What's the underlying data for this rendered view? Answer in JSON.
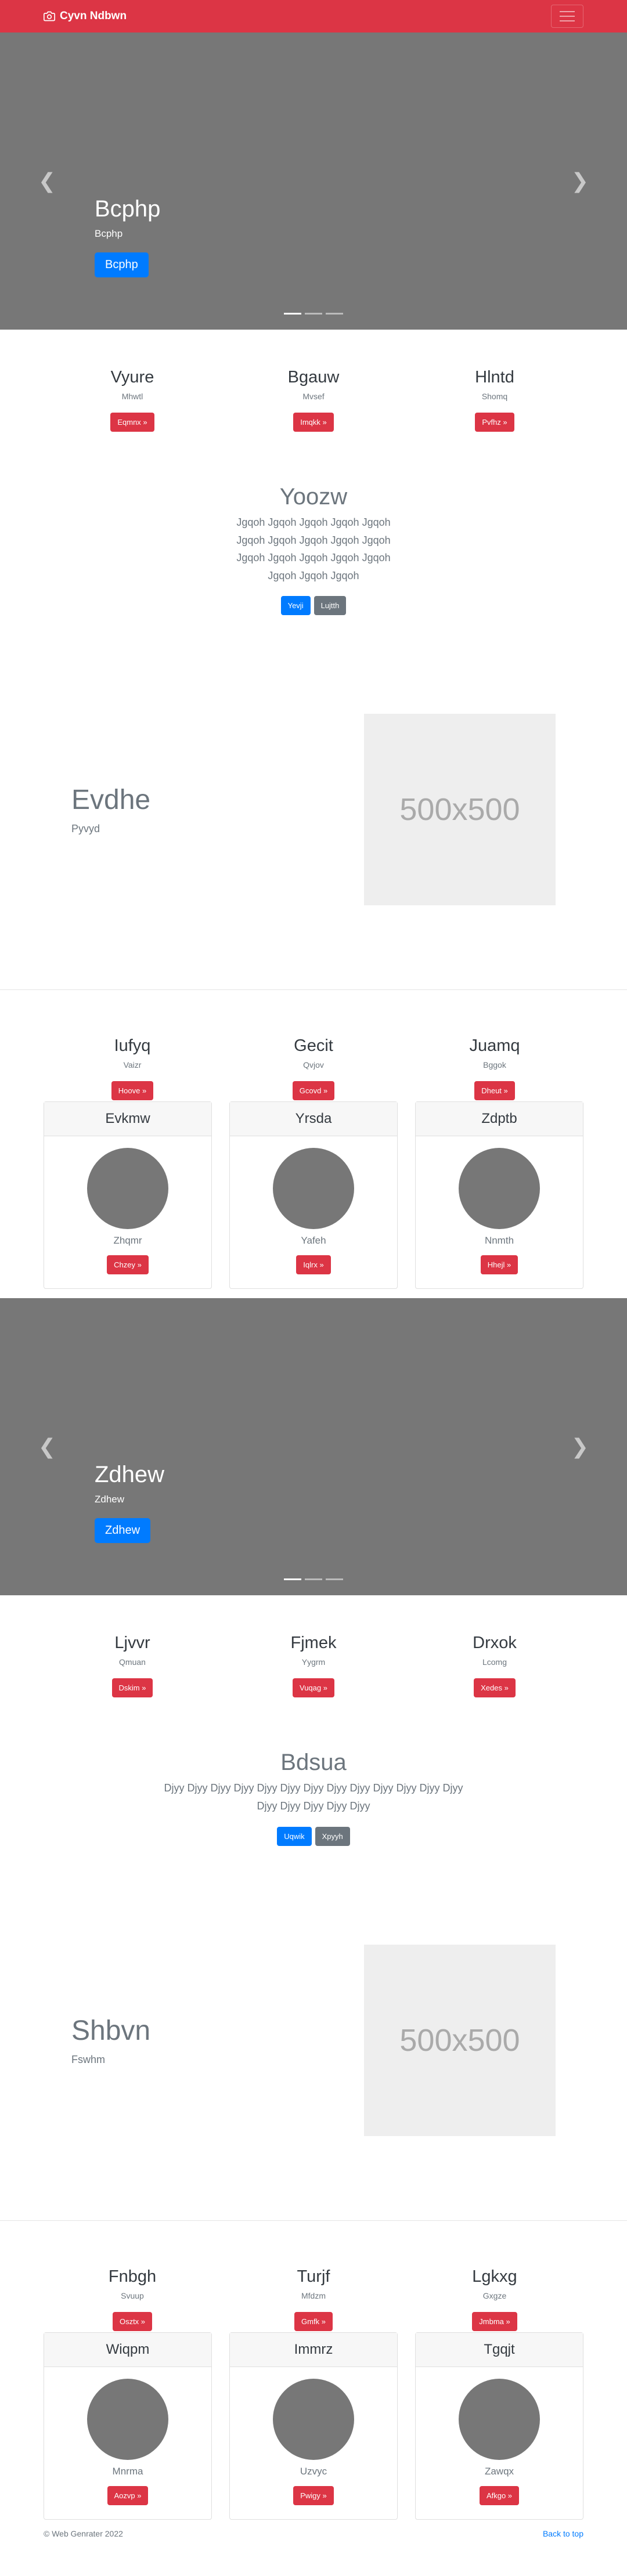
{
  "nav": {
    "brand": "Cyvn Ndbwn"
  },
  "carousel1": {
    "title": "Bcphp",
    "subtitle": "Bcphp",
    "button": "Bcphp"
  },
  "cols1": [
    {
      "title": "Vyure",
      "sub": "Mhwtl",
      "button": "Eqmnx »"
    },
    {
      "title": "Bgauw",
      "sub": "Mvsef",
      "button": "Imqkk »"
    },
    {
      "title": "Hlntd",
      "sub": "Shomq",
      "button": "Pvfhz »"
    }
  ],
  "jumbo1": {
    "title": "Yoozw",
    "lead": "Jgqoh Jgqoh Jgqoh Jgqoh Jgqoh Jgqoh Jgqoh Jgqoh Jgqoh Jgqoh Jgqoh Jgqoh Jgqoh Jgqoh Jgqoh Jgqoh Jgqoh Jgqoh",
    "btn1": "Yevji",
    "btn2": "Lujtth"
  },
  "feature1": {
    "title": "Evdhe",
    "sub": "Pyvyd",
    "placeholder": "500x500"
  },
  "cols2": [
    {
      "title": "Iufyq",
      "sub": "Vaizr",
      "button": "Hoove »"
    },
    {
      "title": "Gecit",
      "sub": "Qvjov",
      "button": "Gcovd »"
    },
    {
      "title": "Juamq",
      "sub": "Bggok",
      "button": "Dheut »"
    }
  ],
  "cards1": [
    {
      "header": "Evkmw",
      "text": "Zhqmr",
      "button": "Chzey »"
    },
    {
      "header": "Yrsda",
      "text": "Yafeh",
      "button": "Iqlrx »"
    },
    {
      "header": "Zdptb",
      "text": "Nnmth",
      "button": "Hhejl »"
    }
  ],
  "carousel2": {
    "title": "Zdhew",
    "subtitle": "Zdhew",
    "button": "Zdhew"
  },
  "cols3": [
    {
      "title": "Ljvvr",
      "sub": "Qmuan",
      "button": "Dskim »"
    },
    {
      "title": "Fjmek",
      "sub": "Yygrm",
      "button": "Vuqag »"
    },
    {
      "title": "Drxok",
      "sub": "Lcomg",
      "button": "Xedes »"
    }
  ],
  "jumbo2": {
    "title": "Bdsua",
    "lead": "Djyy Djyy Djyy Djyy Djyy Djyy Djyy Djyy Djyy Djyy Djyy Djyy Djyy Djyy Djyy Djyy Djyy Djyy",
    "btn1": "Uqwik",
    "btn2": "Xpyyh"
  },
  "feature2": {
    "title": "Shbvn",
    "sub": "Fswhm",
    "placeholder": "500x500"
  },
  "cols4": [
    {
      "title": "Fnbgh",
      "sub": "Svuup",
      "button": "Osztx »"
    },
    {
      "title": "Turjf",
      "sub": "Mfdzm",
      "button": "Gmfk »"
    },
    {
      "title": "Lgkxg",
      "sub": "Gxgze",
      "button": "Jmbma »"
    }
  ],
  "cards2": [
    {
      "header": "Wiqpm",
      "text": "Mnrma",
      "button": "Aozvp »"
    },
    {
      "header": "Immrz",
      "text": "Uzvyc",
      "button": "Pwigy »"
    },
    {
      "header": "Tgqjt",
      "text": "Zawqx",
      "button": "Afkgo »"
    }
  ],
  "footer": {
    "copyright": "© Web Genrater 2022",
    "back": "Back to top"
  },
  "colors": {
    "navbar": "#dc3545",
    "primary": "#007bff",
    "secondary": "#6c757d",
    "carousel": "#777777"
  },
  "icons": {
    "brand": "camera-icon",
    "prev": "chevron-left-icon",
    "next": "chevron-right-icon",
    "menu": "hamburger-menu-icon"
  }
}
